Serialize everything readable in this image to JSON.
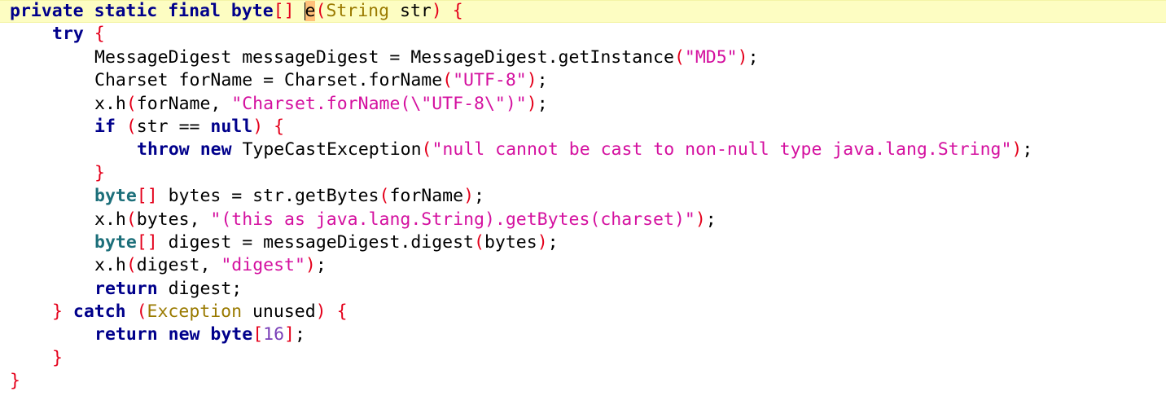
{
  "editor": {
    "current_line_color": "#fdfdc2",
    "colors": {
      "keyword": "#00008b",
      "string": "#d4109f",
      "number": "#7a3fb8",
      "bracket": "#e4001b",
      "type": "#9a7a00"
    },
    "lines": [
      {
        "indent": 0,
        "current": true,
        "tokens": [
          {
            "t": "private",
            "c": "kw"
          },
          {
            "t": " ",
            "c": "id"
          },
          {
            "t": "static",
            "c": "kw"
          },
          {
            "t": " ",
            "c": "id"
          },
          {
            "t": "final",
            "c": "kw"
          },
          {
            "t": " ",
            "c": "id"
          },
          {
            "t": "byte",
            "c": "kw"
          },
          {
            "t": "[]",
            "c": "br"
          },
          {
            "t": " ",
            "c": "id"
          },
          {
            "t": "e",
            "c": "hl"
          },
          {
            "t": "(",
            "c": "br"
          },
          {
            "t": "String",
            "c": "type"
          },
          {
            "t": " str",
            "c": "id"
          },
          {
            "t": ")",
            "c": "br"
          },
          {
            "t": " ",
            "c": "id"
          },
          {
            "t": "{",
            "c": "br"
          }
        ]
      },
      {
        "indent": 1,
        "tokens": [
          {
            "t": "try",
            "c": "kw"
          },
          {
            "t": " ",
            "c": "id"
          },
          {
            "t": "{",
            "c": "br"
          }
        ]
      },
      {
        "indent": 2,
        "tokens": [
          {
            "t": "MessageDigest messageDigest = MessageDigest.getInstance",
            "c": "id"
          },
          {
            "t": "(",
            "c": "br"
          },
          {
            "t": "\"MD5\"",
            "c": "str"
          },
          {
            "t": ")",
            "c": "br"
          },
          {
            "t": ";",
            "c": "id"
          }
        ]
      },
      {
        "indent": 2,
        "tokens": [
          {
            "t": "Charset forName = Charset.forName",
            "c": "id"
          },
          {
            "t": "(",
            "c": "br"
          },
          {
            "t": "\"UTF-8\"",
            "c": "str"
          },
          {
            "t": ")",
            "c": "br"
          },
          {
            "t": ";",
            "c": "id"
          }
        ]
      },
      {
        "indent": 2,
        "tokens": [
          {
            "t": "x.h",
            "c": "id"
          },
          {
            "t": "(",
            "c": "br"
          },
          {
            "t": "forName, ",
            "c": "id"
          },
          {
            "t": "\"Charset.forName(\\\"UTF-8\\\")\"",
            "c": "str"
          },
          {
            "t": ")",
            "c": "br"
          },
          {
            "t": ";",
            "c": "id"
          }
        ]
      },
      {
        "indent": 2,
        "tokens": [
          {
            "t": "if",
            "c": "kw"
          },
          {
            "t": " ",
            "c": "id"
          },
          {
            "t": "(",
            "c": "br"
          },
          {
            "t": "str == ",
            "c": "id"
          },
          {
            "t": "null",
            "c": "kw"
          },
          {
            "t": ")",
            "c": "br"
          },
          {
            "t": " ",
            "c": "id"
          },
          {
            "t": "{",
            "c": "br"
          }
        ]
      },
      {
        "indent": 3,
        "tokens": [
          {
            "t": "throw",
            "c": "kw"
          },
          {
            "t": " ",
            "c": "id"
          },
          {
            "t": "new",
            "c": "kw"
          },
          {
            "t": " TypeCastException",
            "c": "id"
          },
          {
            "t": "(",
            "c": "br"
          },
          {
            "t": "\"null cannot be cast to non-null type java.lang.String\"",
            "c": "str"
          },
          {
            "t": ")",
            "c": "br"
          },
          {
            "t": ";",
            "c": "id"
          }
        ]
      },
      {
        "indent": 2,
        "tokens": [
          {
            "t": "}",
            "c": "br"
          }
        ]
      },
      {
        "indent": 2,
        "tokens": [
          {
            "t": "byte",
            "c": "kw2"
          },
          {
            "t": "[]",
            "c": "br"
          },
          {
            "t": " bytes = str.getBytes",
            "c": "id"
          },
          {
            "t": "(",
            "c": "br"
          },
          {
            "t": "forName",
            "c": "id"
          },
          {
            "t": ")",
            "c": "br"
          },
          {
            "t": ";",
            "c": "id"
          }
        ]
      },
      {
        "indent": 2,
        "tokens": [
          {
            "t": "x.h",
            "c": "id"
          },
          {
            "t": "(",
            "c": "br"
          },
          {
            "t": "bytes, ",
            "c": "id"
          },
          {
            "t": "\"(this as java.lang.String).getBytes(charset)\"",
            "c": "str"
          },
          {
            "t": ")",
            "c": "br"
          },
          {
            "t": ";",
            "c": "id"
          }
        ]
      },
      {
        "indent": 2,
        "tokens": [
          {
            "t": "byte",
            "c": "kw2"
          },
          {
            "t": "[]",
            "c": "br"
          },
          {
            "t": " digest = messageDigest.digest",
            "c": "id"
          },
          {
            "t": "(",
            "c": "br"
          },
          {
            "t": "bytes",
            "c": "id"
          },
          {
            "t": ")",
            "c": "br"
          },
          {
            "t": ";",
            "c": "id"
          }
        ]
      },
      {
        "indent": 2,
        "tokens": [
          {
            "t": "x.h",
            "c": "id"
          },
          {
            "t": "(",
            "c": "br"
          },
          {
            "t": "digest, ",
            "c": "id"
          },
          {
            "t": "\"digest\"",
            "c": "str"
          },
          {
            "t": ")",
            "c": "br"
          },
          {
            "t": ";",
            "c": "id"
          }
        ]
      },
      {
        "indent": 2,
        "tokens": [
          {
            "t": "return",
            "c": "kw"
          },
          {
            "t": " digest;",
            "c": "id"
          }
        ]
      },
      {
        "indent": 1,
        "tokens": [
          {
            "t": "}",
            "c": "br"
          },
          {
            "t": " ",
            "c": "id"
          },
          {
            "t": "catch",
            "c": "kw"
          },
          {
            "t": " ",
            "c": "id"
          },
          {
            "t": "(",
            "c": "br"
          },
          {
            "t": "Exception",
            "c": "type"
          },
          {
            "t": " unused",
            "c": "id"
          },
          {
            "t": ")",
            "c": "br"
          },
          {
            "t": " ",
            "c": "id"
          },
          {
            "t": "{",
            "c": "br"
          }
        ]
      },
      {
        "indent": 2,
        "tokens": [
          {
            "t": "return",
            "c": "kw"
          },
          {
            "t": " ",
            "c": "id"
          },
          {
            "t": "new",
            "c": "kw"
          },
          {
            "t": " ",
            "c": "id"
          },
          {
            "t": "byte",
            "c": "kw"
          },
          {
            "t": "[",
            "c": "br"
          },
          {
            "t": "16",
            "c": "num"
          },
          {
            "t": "]",
            "c": "br"
          },
          {
            "t": ";",
            "c": "id"
          }
        ]
      },
      {
        "indent": 1,
        "tokens": [
          {
            "t": "}",
            "c": "br"
          }
        ]
      },
      {
        "indent": 0,
        "tokens": [
          {
            "t": "}",
            "c": "br"
          }
        ]
      }
    ]
  }
}
